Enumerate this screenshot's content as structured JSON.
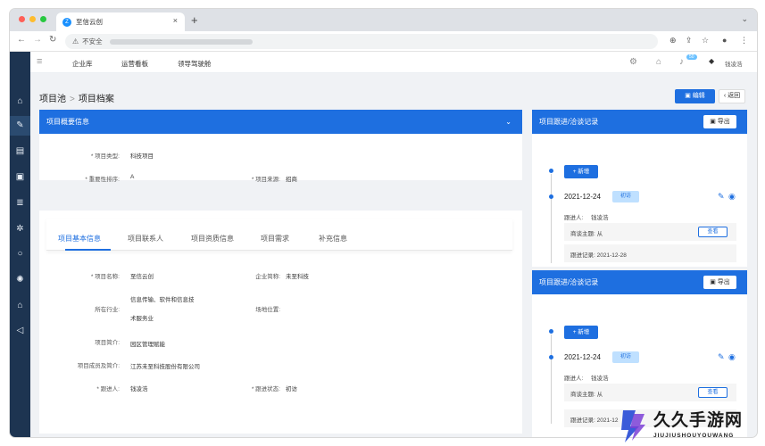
{
  "browser": {
    "tab_title": "至信云创",
    "insecure_label": "不安全",
    "new_tab": "+",
    "close": "×"
  },
  "topnav": {
    "items": [
      "企业库",
      "运营看板",
      "领导驾驶舱"
    ],
    "badge": "50",
    "user": "钱凌浩"
  },
  "breadcrumb": {
    "parent": "项目池",
    "sep": ">",
    "current": "项目档案"
  },
  "actions": {
    "edit": "编辑",
    "back": "返回"
  },
  "overview": {
    "title": "项目概要信息",
    "fields": {
      "type_label": "* 项目类型:",
      "type_value": "科技项目",
      "priority_label": "* 重要性排序:",
      "priority_value": "A",
      "source_label": "* 项目来源:",
      "source_value": "招商"
    }
  },
  "basic": {
    "tabs": [
      "项目基本信息",
      "项目联系人",
      "项目资质信息",
      "项目需求",
      "补充信息"
    ],
    "fields": {
      "name_label": "* 项目名称:",
      "name_value": "至信云创",
      "short_label": "企业简称:",
      "short_value": "未至科技",
      "industry_label": "所在行业:",
      "industry_value1": "信息传输、软件和信息技",
      "industry_value2": "术服务业",
      "site_label": "场地位置:",
      "intro_label": "项目简介:",
      "intro_value": "园区管理赋能",
      "members_label": "项目成员及简介:",
      "members_value": "江苏未至科技股份有限公司",
      "follower_label": "* 跟进人:",
      "follower_value": "钱凌浩",
      "status_label": "* 跟进状态:",
      "status_value": "初访"
    }
  },
  "records": [
    {
      "title": "项目跟进/洽谈记录",
      "export": "导出",
      "add": "新增",
      "date": "2021-12-24",
      "tag": "初访",
      "person": "跟进人:",
      "person_value": "钱凌浩",
      "topic": "商谈主题: 从",
      "view": "查看",
      "record": "跟进记录: 2021-12-28"
    },
    {
      "title": "项目跟进/洽谈记录",
      "export": "导出",
      "add": "新增",
      "date": "2021-12-24",
      "tag": "初访",
      "person": "跟进人:",
      "person_value": "钱凌浩",
      "topic": "商谈主题: 从",
      "view": "查看",
      "record": "跟进记录: 2021-12"
    }
  ],
  "watermark": {
    "text": "久久手游网",
    "sub": "JIUJIUSHOUYOUWANG"
  }
}
